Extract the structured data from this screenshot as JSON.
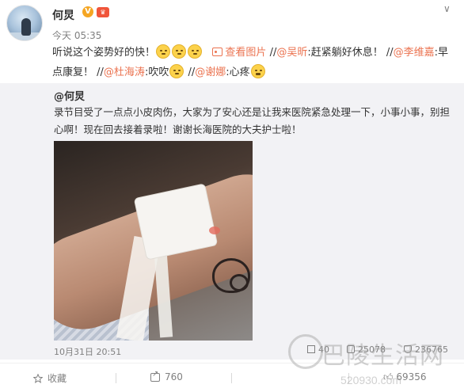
{
  "post": {
    "author": "何炅",
    "verified_badge": "V",
    "level_badge": "会员",
    "time": "今天 05:35",
    "text_parts": {
      "t1": "听说这个姿势好的快！",
      "view_image": "查看图片",
      "sep1": " //",
      "m1": "@吴昕",
      "t2": ":赶紧躺好休息！",
      "sep2": " //",
      "m2": "@李维嘉",
      "t3": ":早点康复！",
      "sep3": " //",
      "m3": "@杜海涛",
      "t4": ":吹吹",
      "sep4": " //",
      "m4": "@谢娜",
      "t5": ":心疼"
    },
    "emoji_names": [
      "sweat-smile-emoji",
      "sweat-smile-emoji",
      "sweat-smile-emoji",
      "blow-emoji",
      "hug-emoji",
      "crying-emoji"
    ]
  },
  "repost": {
    "author": "@何炅",
    "text": "录节目受了一点点小皮肉伤，大家为了安心还是让我来医院紧急处理一下，小事小事，别担心啊！现在回去接着录啦！谢谢长海医院的大夫护士啦！",
    "date": "10月31日 20:51",
    "stats": {
      "forward": "40",
      "comments": "25078",
      "likes": "236765"
    }
  },
  "toolbar": {
    "favorite_label": "收藏",
    "forward_count": "760",
    "comment_count": "",
    "like_count": "69356"
  },
  "watermark": {
    "text": "巴陵生活网",
    "url": "520930.com"
  },
  "colors": {
    "link": "#eb7350",
    "repost_bg": "#f2f2f5",
    "meta": "#808080"
  }
}
